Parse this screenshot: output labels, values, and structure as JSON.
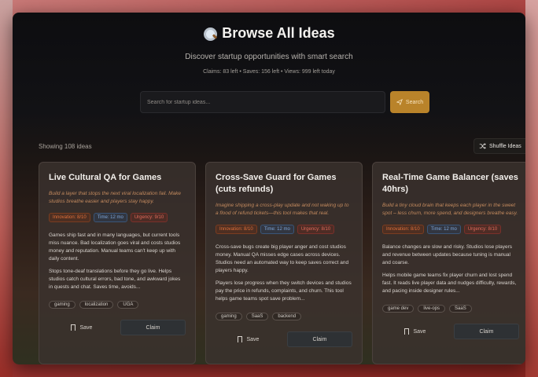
{
  "header": {
    "title": "Browse All Ideas",
    "subtitle": "Discover startup opportunities with smart search",
    "stats": "Claims: 83 left • Saves: 156 left • Views: 999 left today"
  },
  "search": {
    "placeholder": "Search for startup ideas...",
    "button_label": "Search",
    "button_color": "#b9832a"
  },
  "results": {
    "showing": "Showing 108 ideas",
    "shuffle_label": "Shuffle Ideas"
  },
  "cards": [
    {
      "title": "Live Cultural QA for Games",
      "tagline": "Build a layer that stops the next viral localization fail. Make studios breathe easier and players stay happy.",
      "metrics": [
        "Innovation: 8/10",
        "Time: 12 mo",
        "Urgency: 9/10"
      ],
      "body": [
        "Games ship fast and in many languages, but current tools miss nuance. Bad localization goes viral and costs studios money and reputation. Manual teams can't keep up with daily content.",
        "Stops tone-deaf translations before they go live. Helps studios catch cultural errors, bad tone, and awkward jokes in quests and chat. Saves time, avoids..."
      ],
      "tags": [
        "gaming",
        "localization",
        "UGA"
      ],
      "save_label": "Save",
      "claim_label": "Claim"
    },
    {
      "title": "Cross-Save Guard for Games (cuts refunds)",
      "tagline": "Imagine shipping a cross-play update and not waking up to a flood of refund tickets—this tool makes that real.",
      "metrics": [
        "Innovation: 8/10",
        "Time: 12 mo",
        "Urgency: 8/10"
      ],
      "body": [
        "Cross-save bugs create big player anger and cost studios money. Manual QA misses edge cases across devices. Studios need an automated way to keep saves correct and players happy.",
        "Players lose progress when they switch devices and studios pay the price in refunds, complaints, and churn. This tool helps game teams spot save problem..."
      ],
      "tags": [
        "gaming",
        "SaaS",
        "backend"
      ],
      "save_label": "Save",
      "claim_label": "Claim"
    },
    {
      "title": "Real-Time Game Balancer (saves 40hrs)",
      "tagline": "Build a tiny cloud brain that keeps each player in the sweet spot – less churn, more spend, and designers breathe easy.",
      "metrics": [
        "Innovation: 8/10",
        "Time: 12 mo",
        "Urgency: 8/10"
      ],
      "body": [
        "Balance changes are slow and risky. Studios lose players and revenue between updates because tuning is manual and coarse.",
        "Helps mobile game teams fix player churn and lost spend fast. It reads live player data and nudges difficulty, rewards, and pacing inside designer rules..."
      ],
      "tags": [
        "game dev",
        "live-ops",
        "SaaS"
      ],
      "save_label": "Save",
      "claim_label": "Claim"
    }
  ]
}
